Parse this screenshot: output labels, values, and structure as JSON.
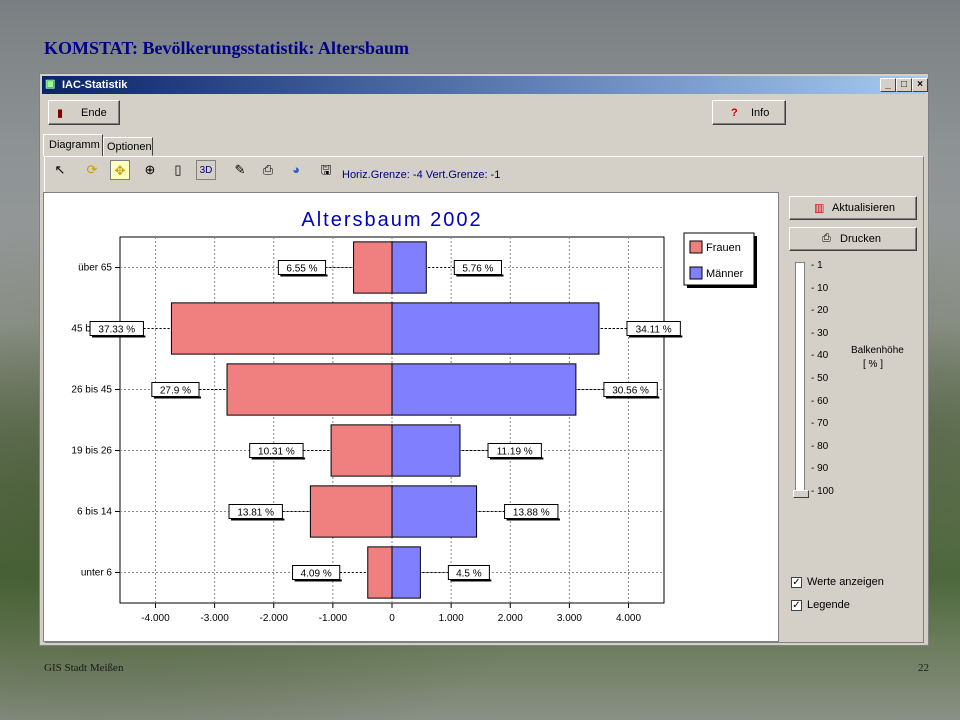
{
  "slide": {
    "title": "KOMSTAT: Bevölkerungsstatistik: Altersbaum",
    "footer_left": "GIS Stadt Meißen",
    "page_number": "22"
  },
  "window": {
    "title": "IAC-Statistik",
    "min_label": "_",
    "max_label": "□",
    "close_label": "×"
  },
  "toolbar": {
    "ende_label": "Ende",
    "info_label": "Info",
    "threed_label": "3D",
    "grenze_text": "Horiz.Grenze: -4 Vert.Grenze: -1"
  },
  "tabs": [
    {
      "label": "Diagramm",
      "active": true
    },
    {
      "label": "Optionen",
      "active": false
    }
  ],
  "right_panel": {
    "aktualisieren_label": "Aktualisieren",
    "drucken_label": "Drucken",
    "balkenhoehe_label": "Balkenhöhe",
    "balkenhoehe_unit": "[ % ]",
    "slider_ticks": [
      "1",
      "10",
      "20",
      "30",
      "40",
      "50",
      "60",
      "70",
      "80",
      "90",
      "100"
    ],
    "slider_value": "100",
    "werte_anzeigen_label": "Werte anzeigen",
    "werte_anzeigen_checked": true,
    "legende_label": "Legende",
    "legende_checked": true
  },
  "chart_data": {
    "type": "bar",
    "orientation": "horizontal-diverging",
    "title": "Altersbaum 2002",
    "categories": [
      "über 65",
      "45 bis 65",
      "26 bis 45",
      "19 bis 26",
      "6 bis 14",
      "unter 6"
    ],
    "series": [
      {
        "name": "Frauen",
        "color": "#f08080",
        "values": [
          -650,
          -3730,
          -2790,
          -1030,
          -1380,
          -410
        ],
        "labels": [
          "6.55 %",
          "37.33 %",
          "27.9 %",
          "10.31 %",
          "13.81 %",
          "4.09 %"
        ]
      },
      {
        "name": "Männer",
        "color": "#8080ff",
        "values": [
          580,
          3500,
          3110,
          1150,
          1430,
          480
        ],
        "labels": [
          "5.76 %",
          "34.11 %",
          "30.56 %",
          "11.19 %",
          "13.88 %",
          "4.5 %"
        ]
      }
    ],
    "x_ticks": [
      "-4.000",
      "-3.000",
      "-2.000",
      "-1.000",
      "0",
      "1.000",
      "2.000",
      "3.000",
      "4.000"
    ],
    "xlim": [
      -4600,
      4600
    ],
    "grid": true,
    "legend_position": "top-right"
  }
}
